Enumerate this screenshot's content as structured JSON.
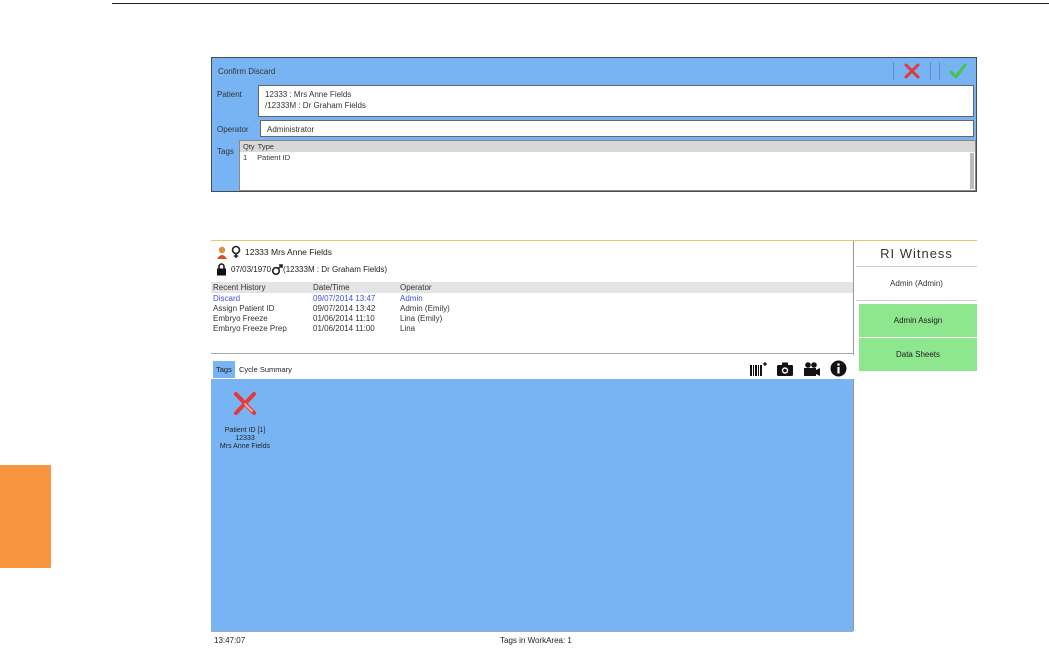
{
  "confirm_discard": {
    "title": "Confirm Discard",
    "patient_label": "Patient",
    "patient_line1": "12333 : Mrs Anne Fields",
    "patient_line2": "/12333M : Dr Graham Fields",
    "operator_label": "Operator",
    "operator_value": "Administrator",
    "tags_label": "Tags",
    "tags_columns": [
      "Qty",
      "Type"
    ],
    "tags_rows": [
      {
        "qty": "1",
        "type": "Patient ID"
      }
    ],
    "cancel_icon": "x-icon",
    "confirm_icon": "check-icon",
    "colors": {
      "panel": "#78b4f4",
      "cancel": "#e53935",
      "confirm": "#43c443"
    }
  },
  "patient": {
    "female_icon": "female-icon",
    "id_name": "12333 Mrs Anne Fields",
    "dob": "07/03/1970",
    "partner": "(12333M : Dr Graham Fields)",
    "lock_icon": "lock-icon",
    "male_icon": "male-icon"
  },
  "history": {
    "columns": [
      "Recent History",
      "Date/Time",
      "Operator"
    ],
    "rows": [
      {
        "event": "Discard",
        "datetime": "09/07/2014 13:47",
        "operator": "Admin"
      },
      {
        "event": "Assign Patient ID",
        "datetime": "09/07/2014 13:42",
        "operator": "Admin (Emily)"
      },
      {
        "event": "Embryo Freeze",
        "datetime": "01/06/2014 11:10",
        "operator": "Lina (Emily)"
      },
      {
        "event": "Embryo Freeze Prep",
        "datetime": "01/06/2014 11:00",
        "operator": "Lina"
      }
    ]
  },
  "tabs": [
    "Tags",
    "Cycle Summary"
  ],
  "toolbar_icons": [
    "barcode-add-icon",
    "camera-icon",
    "video-camera-icon",
    "info-icon"
  ],
  "tile": {
    "icon": "x-icon",
    "label": "Patient ID [1]",
    "id": "12333",
    "name": "Mrs Anne Fields"
  },
  "status": {
    "time": "13:47:07",
    "tags_count": "Tags in WorkArea: 1"
  },
  "sidebar": {
    "brand": "RI Witness",
    "user": "Admin (Admin)",
    "buttons": [
      "Admin Assign",
      "Data Sheets"
    ]
  }
}
